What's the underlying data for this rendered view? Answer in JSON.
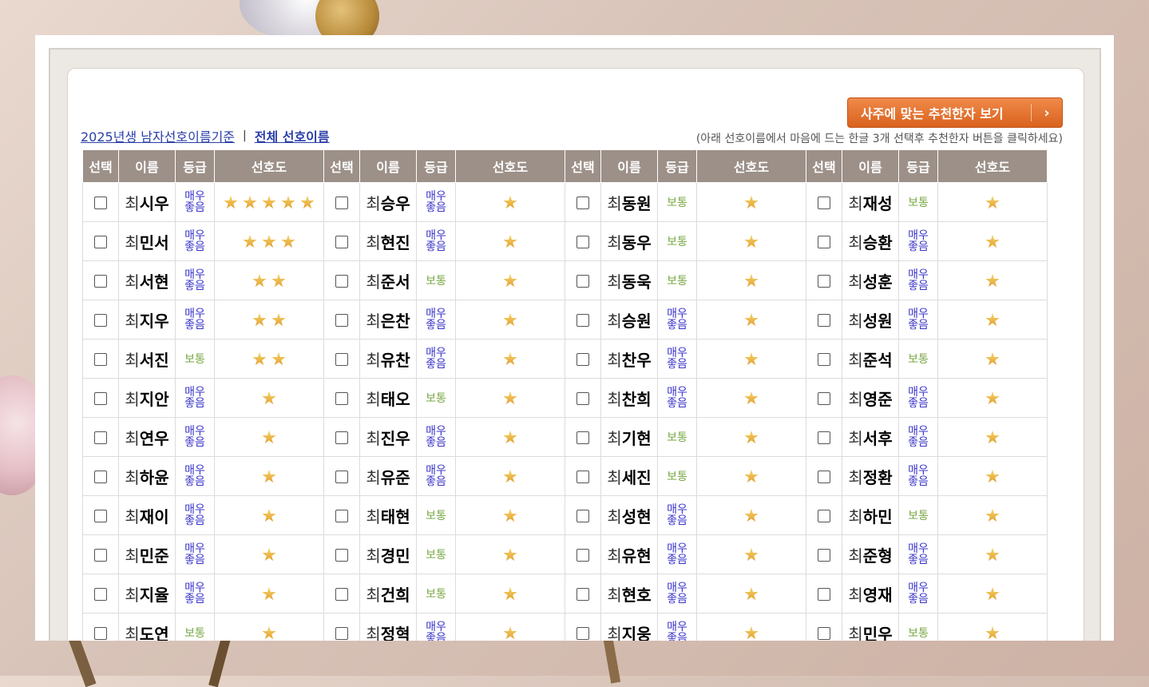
{
  "button": {
    "label": "사주에 맞는 추천한자 보기",
    "arrow": "›"
  },
  "links": {
    "primary": "2025년생 남자선호이름기준",
    "separator": "|",
    "secondary": "전체 선호이름"
  },
  "instruction": "(아래 선호이름에서 마음에 드는 한글 3개 선택후 추천한자 버튼을 클릭하세요)",
  "headers": [
    "선택",
    "이름",
    "등급",
    "선호도"
  ],
  "surname": "최",
  "grade_labels": {
    "good": "매우좋음",
    "normal": "보통"
  },
  "colors": {
    "header_bg": "#9c9088",
    "button_orange": "#e8732f",
    "link_blue": "#2a3fa8",
    "grade_good": "#3a35c8",
    "grade_normal": "#7aa845",
    "star_gold": "#f0b840"
  },
  "rows": [
    [
      {
        "name": "시우",
        "grade": "good",
        "stars": 5
      },
      {
        "name": "승우",
        "grade": "good",
        "stars": 1
      },
      {
        "name": "동원",
        "grade": "normal",
        "stars": 1
      },
      {
        "name": "재성",
        "grade": "normal",
        "stars": 1
      }
    ],
    [
      {
        "name": "민서",
        "grade": "good",
        "stars": 3
      },
      {
        "name": "현진",
        "grade": "good",
        "stars": 1
      },
      {
        "name": "동우",
        "grade": "normal",
        "stars": 1
      },
      {
        "name": "승환",
        "grade": "good",
        "stars": 1
      }
    ],
    [
      {
        "name": "서현",
        "grade": "good",
        "stars": 2
      },
      {
        "name": "준서",
        "grade": "normal",
        "stars": 1
      },
      {
        "name": "동욱",
        "grade": "normal",
        "stars": 1
      },
      {
        "name": "성훈",
        "grade": "good",
        "stars": 1
      }
    ],
    [
      {
        "name": "지우",
        "grade": "good",
        "stars": 2
      },
      {
        "name": "은찬",
        "grade": "good",
        "stars": 1
      },
      {
        "name": "승원",
        "grade": "good",
        "stars": 1
      },
      {
        "name": "성원",
        "grade": "good",
        "stars": 1
      }
    ],
    [
      {
        "name": "서진",
        "grade": "normal",
        "stars": 2
      },
      {
        "name": "유찬",
        "grade": "good",
        "stars": 1
      },
      {
        "name": "찬우",
        "grade": "good",
        "stars": 1
      },
      {
        "name": "준석",
        "grade": "normal",
        "stars": 1
      }
    ],
    [
      {
        "name": "지안",
        "grade": "good",
        "stars": 1
      },
      {
        "name": "태오",
        "grade": "normal",
        "stars": 1
      },
      {
        "name": "찬희",
        "grade": "good",
        "stars": 1
      },
      {
        "name": "영준",
        "grade": "good",
        "stars": 1
      }
    ],
    [
      {
        "name": "연우",
        "grade": "good",
        "stars": 1
      },
      {
        "name": "진우",
        "grade": "good",
        "stars": 1
      },
      {
        "name": "기현",
        "grade": "normal",
        "stars": 1
      },
      {
        "name": "서후",
        "grade": "good",
        "stars": 1
      }
    ],
    [
      {
        "name": "하윤",
        "grade": "good",
        "stars": 1
      },
      {
        "name": "유준",
        "grade": "good",
        "stars": 1
      },
      {
        "name": "세진",
        "grade": "normal",
        "stars": 1
      },
      {
        "name": "정환",
        "grade": "good",
        "stars": 1
      }
    ],
    [
      {
        "name": "재이",
        "grade": "good",
        "stars": 1
      },
      {
        "name": "태현",
        "grade": "normal",
        "stars": 1
      },
      {
        "name": "성현",
        "grade": "good",
        "stars": 1
      },
      {
        "name": "하민",
        "grade": "normal",
        "stars": 1
      }
    ],
    [
      {
        "name": "민준",
        "grade": "good",
        "stars": 1
      },
      {
        "name": "경민",
        "grade": "normal",
        "stars": 1
      },
      {
        "name": "유현",
        "grade": "good",
        "stars": 1
      },
      {
        "name": "준형",
        "grade": "good",
        "stars": 1
      }
    ],
    [
      {
        "name": "지율",
        "grade": "good",
        "stars": 1
      },
      {
        "name": "건희",
        "grade": "normal",
        "stars": 1
      },
      {
        "name": "현호",
        "grade": "good",
        "stars": 1
      },
      {
        "name": "영재",
        "grade": "good",
        "stars": 1
      }
    ],
    [
      {
        "name": "도연",
        "grade": "normal",
        "stars": 1
      },
      {
        "name": "정혁",
        "grade": "good",
        "stars": 1
      },
      {
        "name": "지웅",
        "grade": "good",
        "stars": 1
      },
      {
        "name": "민우",
        "grade": "normal",
        "stars": 1
      }
    ]
  ]
}
